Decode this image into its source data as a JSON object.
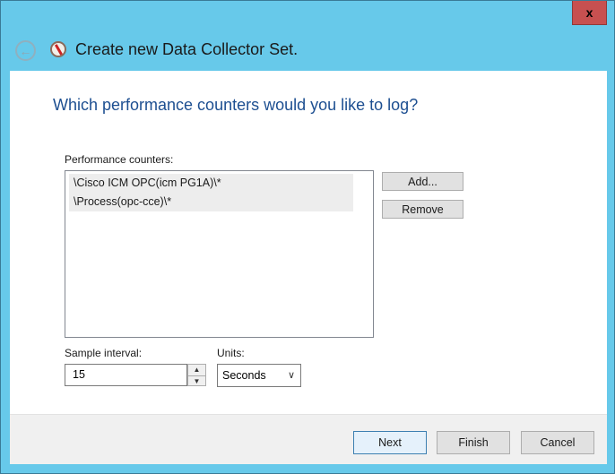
{
  "window": {
    "title": "Create new Data Collector Set.",
    "close_label": "x"
  },
  "page": {
    "heading": "Which performance counters would you like to log?"
  },
  "counters": {
    "label": "Performance counters:",
    "items": [
      "\\Cisco ICM OPC(icm PG1A)\\*",
      "\\Process(opc-cce)\\*"
    ],
    "add_label": "Add...",
    "remove_label": "Remove"
  },
  "sample": {
    "label": "Sample interval:",
    "value": "15"
  },
  "units": {
    "label": "Units:",
    "value": "Seconds"
  },
  "footer": {
    "next": "Next",
    "finish": "Finish",
    "cancel": "Cancel"
  },
  "icons": {
    "back": "back-arrow-icon",
    "app": "performance-monitor-icon",
    "close": "close-icon"
  },
  "colors": {
    "titlebar": "#67c9ea",
    "close": "#c75050",
    "heading": "#1d4f91"
  }
}
